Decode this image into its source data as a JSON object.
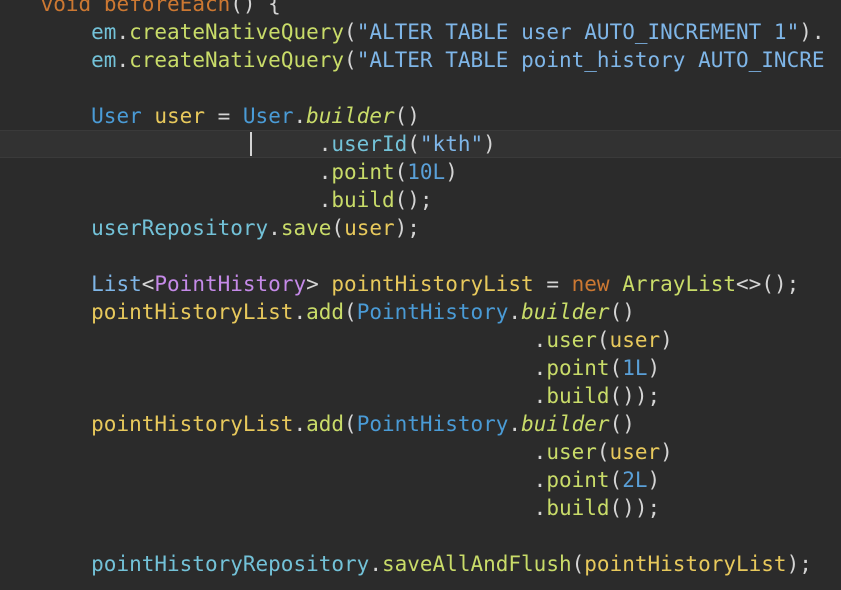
{
  "editor": {
    "lines": [
      [
        {
          "t": "    ",
          "c": "pu"
        },
        {
          "t": "void",
          "c": "kw"
        },
        {
          "t": " ",
          "c": "pu"
        },
        {
          "t": "beforeEach",
          "c": "kw"
        },
        {
          "t": "() {",
          "c": "pu"
        }
      ],
      [
        {
          "t": "        ",
          "c": "pu"
        },
        {
          "t": "em",
          "c": "fn"
        },
        {
          "t": ".",
          "c": "pu"
        },
        {
          "t": "createNativeQuery",
          "c": "mt"
        },
        {
          "t": "(",
          "c": "pu"
        },
        {
          "t": "\"ALTER TABLE user AUTO_INCREMENT 1\"",
          "c": "st"
        },
        {
          "t": ").",
          "c": "pu"
        }
      ],
      [
        {
          "t": "        ",
          "c": "pu"
        },
        {
          "t": "em",
          "c": "fn"
        },
        {
          "t": ".",
          "c": "pu"
        },
        {
          "t": "createNativeQuery",
          "c": "mt"
        },
        {
          "t": "(",
          "c": "pu"
        },
        {
          "t": "\"ALTER TABLE point_history AUTO_INCRE",
          "c": "st"
        }
      ],
      [],
      [
        {
          "t": "        ",
          "c": "pu"
        },
        {
          "t": "User",
          "c": "ty"
        },
        {
          "t": " ",
          "c": "pu"
        },
        {
          "t": "user",
          "c": "vr"
        },
        {
          "t": " = ",
          "c": "pu"
        },
        {
          "t": "User",
          "c": "ty"
        },
        {
          "t": ".",
          "c": "pu"
        },
        {
          "t": "builder",
          "c": "it"
        },
        {
          "t": "()",
          "c": "pu"
        }
      ],
      [
        {
          "t": "                          ",
          "c": "pu"
        },
        {
          "t": ".",
          "c": "pu"
        },
        {
          "t": "userId",
          "c": "fn"
        },
        {
          "t": "(",
          "c": "pu"
        },
        {
          "t": "\"kth\"",
          "c": "st"
        },
        {
          "t": ")",
          "c": "pu"
        }
      ],
      [
        {
          "t": "                          ",
          "c": "pu"
        },
        {
          "t": ".",
          "c": "pu"
        },
        {
          "t": "point",
          "c": "mt"
        },
        {
          "t": "(",
          "c": "pu"
        },
        {
          "t": "10L",
          "c": "nu"
        },
        {
          "t": ")",
          "c": "pu"
        }
      ],
      [
        {
          "t": "                          ",
          "c": "pu"
        },
        {
          "t": ".",
          "c": "pu"
        },
        {
          "t": "build",
          "c": "mt"
        },
        {
          "t": "();",
          "c": "pu"
        }
      ],
      [
        {
          "t": "        ",
          "c": "pu"
        },
        {
          "t": "userRepository",
          "c": "fn"
        },
        {
          "t": ".",
          "c": "pu"
        },
        {
          "t": "save",
          "c": "mt"
        },
        {
          "t": "(",
          "c": "pu"
        },
        {
          "t": "user",
          "c": "vr"
        },
        {
          "t": ");",
          "c": "pu"
        }
      ],
      [],
      [
        {
          "t": "        ",
          "c": "pu"
        },
        {
          "t": "List",
          "c": "tp"
        },
        {
          "t": "<",
          "c": "pu"
        },
        {
          "t": "PointHistory",
          "c": "gn"
        },
        {
          "t": "> ",
          "c": "pu"
        },
        {
          "t": "pointHistoryList",
          "c": "vr"
        },
        {
          "t": " = ",
          "c": "pu"
        },
        {
          "t": "new",
          "c": "kw"
        },
        {
          "t": " ",
          "c": "pu"
        },
        {
          "t": "ArrayList",
          "c": "mt"
        },
        {
          "t": "<>();",
          "c": "pu"
        }
      ],
      [
        {
          "t": "        ",
          "c": "pu"
        },
        {
          "t": "pointHistoryList",
          "c": "vr"
        },
        {
          "t": ".",
          "c": "pu"
        },
        {
          "t": "add",
          "c": "mt"
        },
        {
          "t": "(",
          "c": "pu"
        },
        {
          "t": "PointHistory",
          "c": "ty"
        },
        {
          "t": ".",
          "c": "pu"
        },
        {
          "t": "builder",
          "c": "it"
        },
        {
          "t": "()",
          "c": "pu"
        }
      ],
      [
        {
          "t": "                                           ",
          "c": "pu"
        },
        {
          "t": ".",
          "c": "pu"
        },
        {
          "t": "user",
          "c": "mt"
        },
        {
          "t": "(",
          "c": "pu"
        },
        {
          "t": "user",
          "c": "vr"
        },
        {
          "t": ")",
          "c": "pu"
        }
      ],
      [
        {
          "t": "                                           ",
          "c": "pu"
        },
        {
          "t": ".",
          "c": "pu"
        },
        {
          "t": "point",
          "c": "mt"
        },
        {
          "t": "(",
          "c": "pu"
        },
        {
          "t": "1L",
          "c": "nu"
        },
        {
          "t": ")",
          "c": "pu"
        }
      ],
      [
        {
          "t": "                                           ",
          "c": "pu"
        },
        {
          "t": ".",
          "c": "pu"
        },
        {
          "t": "build",
          "c": "mt"
        },
        {
          "t": "());",
          "c": "pu"
        }
      ],
      [
        {
          "t": "        ",
          "c": "pu"
        },
        {
          "t": "pointHistoryList",
          "c": "vr"
        },
        {
          "t": ".",
          "c": "pu"
        },
        {
          "t": "add",
          "c": "mt"
        },
        {
          "t": "(",
          "c": "pu"
        },
        {
          "t": "PointHistory",
          "c": "ty"
        },
        {
          "t": ".",
          "c": "pu"
        },
        {
          "t": "builder",
          "c": "it"
        },
        {
          "t": "()",
          "c": "pu"
        }
      ],
      [
        {
          "t": "                                           ",
          "c": "pu"
        },
        {
          "t": ".",
          "c": "pu"
        },
        {
          "t": "user",
          "c": "mt"
        },
        {
          "t": "(",
          "c": "pu"
        },
        {
          "t": "user",
          "c": "vr"
        },
        {
          "t": ")",
          "c": "pu"
        }
      ],
      [
        {
          "t": "                                           ",
          "c": "pu"
        },
        {
          "t": ".",
          "c": "pu"
        },
        {
          "t": "point",
          "c": "mt"
        },
        {
          "t": "(",
          "c": "pu"
        },
        {
          "t": "2L",
          "c": "nu"
        },
        {
          "t": ")",
          "c": "pu"
        }
      ],
      [
        {
          "t": "                                           ",
          "c": "pu"
        },
        {
          "t": ".",
          "c": "pu"
        },
        {
          "t": "build",
          "c": "mt"
        },
        {
          "t": "());",
          "c": "pu"
        }
      ],
      [],
      [
        {
          "t": "        ",
          "c": "pu"
        },
        {
          "t": "pointHistoryRepository",
          "c": "fn"
        },
        {
          "t": ".",
          "c": "pu"
        },
        {
          "t": "saveAllAndFlush",
          "c": "mt"
        },
        {
          "t": "(",
          "c": "pu"
        },
        {
          "t": "pointHistoryList",
          "c": "vr"
        },
        {
          "t": ");",
          "c": "pu"
        }
      ]
    ],
    "colors": {
      "background": "#2b2b2b",
      "current_line": "#323232",
      "keyword": "#cc7832",
      "type": "#4a9bd6",
      "generic": "#c58ae8",
      "field": "#73c2d8",
      "method": "#c9dc69",
      "variable": "#e8c95c",
      "string": "#7fb6e8",
      "number": "#5aa0d8",
      "punctuation": "#d4d4d4"
    }
  }
}
